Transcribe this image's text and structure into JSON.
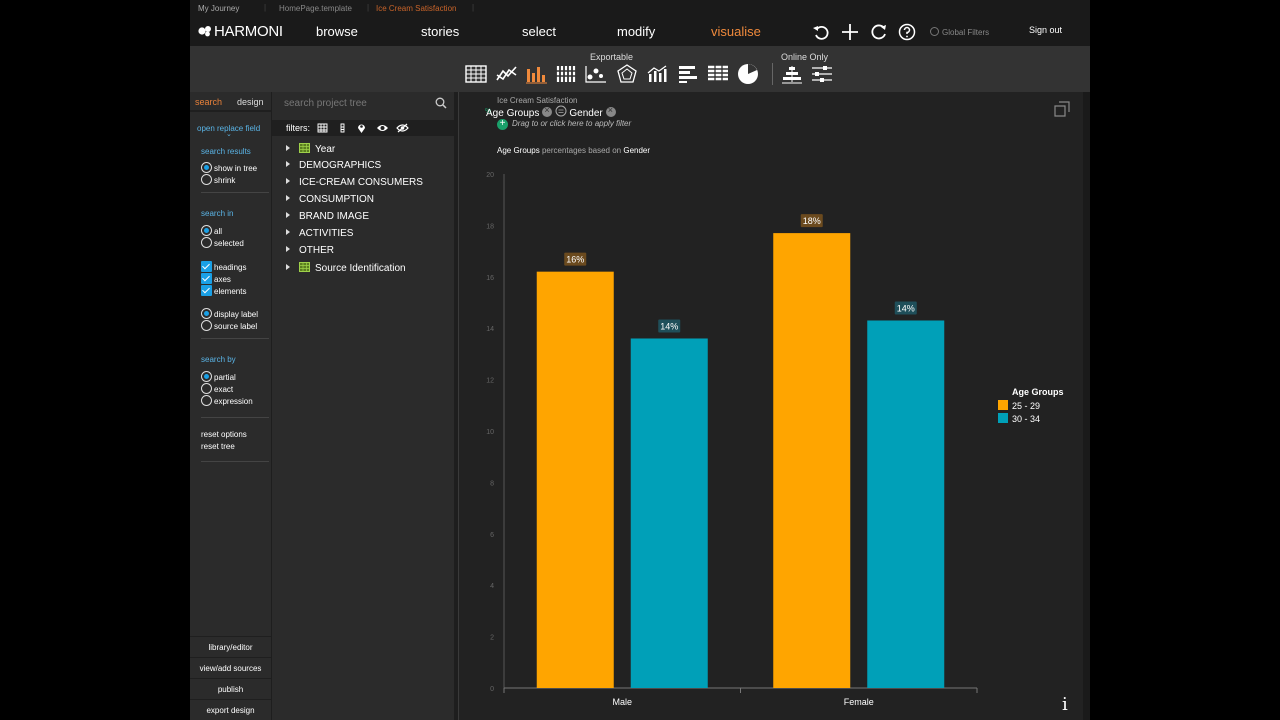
{
  "breadcrumb": [
    "My Journey",
    "HomePage.template",
    "Ice Cream Satisfaction"
  ],
  "brand": "HARMONI",
  "nav": {
    "items": [
      {
        "label": "browse",
        "active": false
      },
      {
        "label": "stories",
        "active": false
      },
      {
        "label": "select",
        "active": false
      },
      {
        "label": "modify",
        "active": false
      },
      {
        "label": "visualise",
        "active": true
      }
    ],
    "icons": [
      "undo-icon",
      "add-icon",
      "refresh-icon",
      "help-icon"
    ],
    "global_filters": "Global Filters",
    "sign_out": "Sign out"
  },
  "toolbar": {
    "caption_exportable": "Exportable",
    "caption_online": "Online Only",
    "exportable_icons": [
      "table-icon",
      "line-chart-icon",
      "bar-chart-icon",
      "stacked-bar-icon",
      "scatter-icon",
      "radar-icon",
      "combo-chart-icon",
      "horizontal-bar-icon",
      "horizontal-stacked-icon",
      "pie-chart-icon"
    ],
    "online_icons": [
      "pyramid-icon",
      "sliders-icon"
    ],
    "active_icon": "bar-chart-icon"
  },
  "sidebar": {
    "tabs": [
      {
        "label": "search",
        "active": true
      },
      {
        "label": "design",
        "active": false
      }
    ],
    "open_replace_field": "open replace field",
    "search_results": {
      "heading": "search results",
      "options": [
        {
          "label": "show in tree",
          "checked": true
        },
        {
          "label": "shrink",
          "checked": false
        }
      ]
    },
    "search_in": {
      "heading": "search in",
      "options": [
        {
          "label": "all",
          "checked": true
        },
        {
          "label": "selected",
          "checked": false
        }
      ]
    },
    "checks": [
      {
        "label": "headings",
        "checked": true
      },
      {
        "label": "axes",
        "checked": true
      },
      {
        "label": "elements",
        "checked": true
      }
    ],
    "label_mode": [
      {
        "label": "display label",
        "checked": true
      },
      {
        "label": "source label",
        "checked": false
      }
    ],
    "search_by": {
      "heading": "search by",
      "options": [
        {
          "label": "partial",
          "checked": true
        },
        {
          "label": "exact",
          "checked": false
        },
        {
          "label": "expression",
          "checked": false
        }
      ]
    },
    "reset_options": "reset options",
    "reset_tree": "reset tree",
    "bottom_buttons": [
      "library/editor",
      "view/add sources",
      "publish",
      "export design"
    ]
  },
  "tree": {
    "search_placeholder": "search project tree",
    "filters_label": "filters:",
    "filter_icons": [
      "grid-filter-icon",
      "vertical-bar-filter-icon",
      "pin-filter-icon",
      "eye-filter-icon",
      "eye-hidden-filter-icon"
    ],
    "items": [
      {
        "label": "Year",
        "icon": "table-icon"
      },
      {
        "label": "DEMOGRAPHICS",
        "icon": ""
      },
      {
        "label": "ICE-CREAM CONSUMERS",
        "icon": ""
      },
      {
        "label": "CONSUMPTION",
        "icon": ""
      },
      {
        "label": "BRAND IMAGE",
        "icon": ""
      },
      {
        "label": "ACTIVITIES",
        "icon": ""
      },
      {
        "label": "OTHER",
        "icon": ""
      },
      {
        "label": "Source Identification",
        "icon": "table-icon"
      }
    ]
  },
  "chart_panel": {
    "source_title": "Ice Cream Satisfaction",
    "row_dimension": "Age Groups",
    "col_dimension": "Gender",
    "filter_hint": "Drag to or click here to apply filter",
    "description_a": "Age Groups",
    "description_mid": "percentages based on",
    "description_b": "Gender"
  },
  "chart_data": {
    "type": "bar",
    "categories": [
      "Male",
      "Female"
    ],
    "series": [
      {
        "name": "25 - 29",
        "values": [
          16.2,
          17.7
        ],
        "labels": [
          "16%",
          "18%"
        ],
        "color": "#FFA500"
      },
      {
        "name": "30 - 34",
        "values": [
          13.6,
          14.3
        ],
        "labels": [
          "14%",
          "14%"
        ],
        "color": "#00A0B8"
      }
    ],
    "ylim": [
      0,
      20
    ],
    "yticks": [
      0,
      2,
      4,
      6,
      8,
      10,
      12,
      14,
      16,
      18,
      20
    ],
    "legend_title": "Age Groups",
    "legend_position": "right",
    "grid": false
  }
}
